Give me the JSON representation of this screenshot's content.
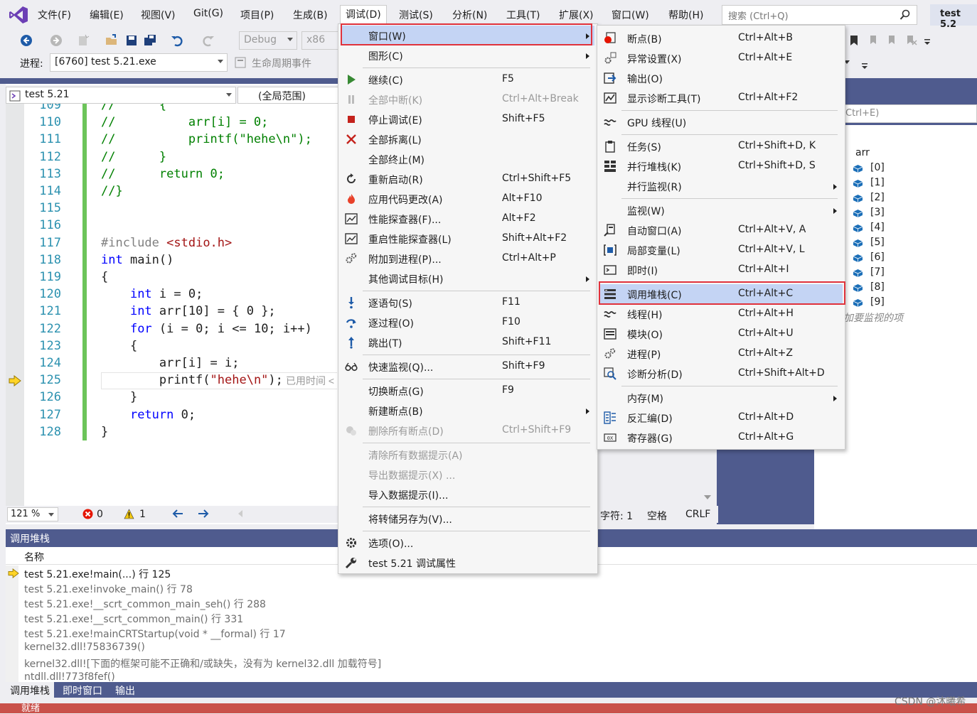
{
  "menubar": {
    "items": [
      "文件(F)",
      "编辑(E)",
      "视图(V)",
      "Git(G)",
      "项目(P)",
      "生成(B)",
      "调试(D)",
      "测试(S)",
      "分析(N)",
      "工具(T)",
      "扩展(X)",
      "窗口(W)",
      "帮助(H)"
    ],
    "search_placeholder": "搜索 (Ctrl+Q)",
    "project_title": "test 5.2"
  },
  "toolbar": {
    "config": "Debug",
    "platform": "x86",
    "process_label": "进程:",
    "process_value": "[6760] test 5.21.exe",
    "lifecycle": "生命周期事件"
  },
  "editor": {
    "scope_combo": "test 5.21",
    "range_combo": "(全局范围)",
    "zoom": "121 %",
    "errors": "0",
    "warnings": "1",
    "status_chars": "字符: 1",
    "status_space": "空格",
    "status_crlf": "CRLF",
    "inline_hint": "已用时间 <",
    "lines": [
      {
        "n": "109",
        "t": "//      {"
      },
      {
        "n": "110",
        "t": "//          arr[i] = 0;"
      },
      {
        "n": "111",
        "t": "//          printf(\"hehe\\n\");"
      },
      {
        "n": "112",
        "t": "//      }"
      },
      {
        "n": "113",
        "t": "//      return 0;"
      },
      {
        "n": "114",
        "t": "//}"
      },
      {
        "n": "115",
        "t": ""
      },
      {
        "n": "116",
        "t": ""
      },
      {
        "n": "117",
        "t": "#include <stdio.h>"
      },
      {
        "n": "118",
        "t": "int main()"
      },
      {
        "n": "119",
        "t": "{"
      },
      {
        "n": "120",
        "t": "    int i = 0;"
      },
      {
        "n": "121",
        "t": "    int arr[10] = { 0 };"
      },
      {
        "n": "122",
        "t": "    for (i = 0; i <= 10; i++)"
      },
      {
        "n": "123",
        "t": "    {"
      },
      {
        "n": "124",
        "t": "        arr[i] = i;"
      },
      {
        "n": "125",
        "t": "        printf(\"hehe\\n\");"
      },
      {
        "n": "126",
        "t": "    }"
      },
      {
        "n": "127",
        "t": "    return 0;"
      },
      {
        "n": "128",
        "t": "}"
      }
    ]
  },
  "debug_menu": [
    {
      "label": "窗口(W)",
      "shortcut": "",
      "sub": true,
      "icon": "",
      "disabled": false
    },
    {
      "label": "图形(C)",
      "shortcut": "",
      "sub": true,
      "icon": "",
      "disabled": false
    },
    {
      "label": "继续(C)",
      "shortcut": "F5",
      "sub": false,
      "icon": "play-icon",
      "disabled": false
    },
    {
      "label": "全部中断(K)",
      "shortcut": "Ctrl+Alt+Break",
      "sub": false,
      "icon": "pause-icon",
      "disabled": true
    },
    {
      "label": "停止调试(E)",
      "shortcut": "Shift+F5",
      "sub": false,
      "icon": "stop-icon",
      "disabled": false
    },
    {
      "label": "全部拆离(L)",
      "shortcut": "",
      "sub": false,
      "icon": "detach-icon",
      "disabled": false
    },
    {
      "label": "全部终止(M)",
      "shortcut": "",
      "sub": false,
      "icon": "",
      "disabled": false
    },
    {
      "label": "重新启动(R)",
      "shortcut": "Ctrl+Shift+F5",
      "sub": false,
      "icon": "restart-icon",
      "disabled": false
    },
    {
      "label": "应用代码更改(A)",
      "shortcut": "Alt+F10",
      "sub": false,
      "icon": "hot-reload-icon",
      "disabled": false
    },
    {
      "label": "性能探查器(F)...",
      "shortcut": "Alt+F2",
      "sub": false,
      "icon": "profiler-icon",
      "disabled": false
    },
    {
      "label": "重启性能探查器(L)",
      "shortcut": "Shift+Alt+F2",
      "sub": false,
      "icon": "profiler-icon",
      "disabled": false
    },
    {
      "label": "附加到进程(P)...",
      "shortcut": "Ctrl+Alt+P",
      "sub": false,
      "icon": "gears-icon",
      "disabled": false
    },
    {
      "label": "其他调试目标(H)",
      "shortcut": "",
      "sub": true,
      "icon": "",
      "disabled": false
    },
    {
      "label": "逐语句(S)",
      "shortcut": "F11",
      "sub": false,
      "icon": "step-into-icon",
      "disabled": false
    },
    {
      "label": "逐过程(O)",
      "shortcut": "F10",
      "sub": false,
      "icon": "step-over-icon",
      "disabled": false
    },
    {
      "label": "跳出(T)",
      "shortcut": "Shift+F11",
      "sub": false,
      "icon": "step-out-icon",
      "disabled": false
    },
    {
      "label": "快速监视(Q)...",
      "shortcut": "Shift+F9",
      "sub": false,
      "icon": "glasses-icon",
      "disabled": false
    },
    {
      "label": "切换断点(G)",
      "shortcut": "F9",
      "sub": false,
      "icon": "",
      "disabled": false
    },
    {
      "label": "新建断点(B)",
      "shortcut": "",
      "sub": true,
      "icon": "",
      "disabled": false
    },
    {
      "label": "删除所有断点(D)",
      "shortcut": "Ctrl+Shift+F9",
      "sub": false,
      "icon": "delete-breakpoints-icon",
      "disabled": true
    },
    {
      "label": "清除所有数据提示(A)",
      "shortcut": "",
      "sub": false,
      "icon": "",
      "disabled": true
    },
    {
      "label": "导出数据提示(X) ...",
      "shortcut": "",
      "sub": false,
      "icon": "",
      "disabled": true
    },
    {
      "label": "导入数据提示(I)...",
      "shortcut": "",
      "sub": false,
      "icon": "",
      "disabled": false
    },
    {
      "label": "将转储另存为(V)...",
      "shortcut": "",
      "sub": false,
      "icon": "",
      "disabled": false
    },
    {
      "label": "选项(O)...",
      "shortcut": "",
      "sub": false,
      "icon": "gear-icon",
      "disabled": false
    },
    {
      "label": "test 5.21 调试属性",
      "shortcut": "",
      "sub": false,
      "icon": "wrench-icon",
      "disabled": false
    }
  ],
  "window_submenu": [
    {
      "label": "断点(B)",
      "shortcut": "Ctrl+Alt+B",
      "sub": false,
      "icon": "breakpoints-icon"
    },
    {
      "label": "异常设置(X)",
      "shortcut": "Ctrl+Alt+E",
      "sub": false,
      "icon": "exception-icon"
    },
    {
      "label": "输出(O)",
      "shortcut": "",
      "sub": false,
      "icon": "output-icon"
    },
    {
      "label": "显示诊断工具(T)",
      "shortcut": "Ctrl+Alt+F2",
      "sub": false,
      "icon": "diagnostics-icon"
    },
    {
      "label": "GPU 线程(U)",
      "shortcut": "",
      "sub": false,
      "icon": "threads-icon"
    },
    {
      "label": "任务(S)",
      "shortcut": "Ctrl+Shift+D, K",
      "sub": false,
      "icon": "tasks-icon"
    },
    {
      "label": "并行堆栈(K)",
      "shortcut": "Ctrl+Shift+D, S",
      "sub": false,
      "icon": "parallel-stacks-icon"
    },
    {
      "label": "并行监视(R)",
      "shortcut": "",
      "sub": true,
      "icon": ""
    },
    {
      "label": "监视(W)",
      "shortcut": "",
      "sub": true,
      "icon": ""
    },
    {
      "label": "自动窗口(A)",
      "shortcut": "Ctrl+Alt+V, A",
      "sub": false,
      "icon": "autos-icon"
    },
    {
      "label": "局部变量(L)",
      "shortcut": "Ctrl+Alt+V, L",
      "sub": false,
      "icon": "locals-icon"
    },
    {
      "label": "即时(I)",
      "shortcut": "Ctrl+Alt+I",
      "sub": false,
      "icon": "immediate-icon"
    },
    {
      "label": "调用堆栈(C)",
      "shortcut": "Ctrl+Alt+C",
      "sub": false,
      "icon": "call-stack-icon"
    },
    {
      "label": "线程(H)",
      "shortcut": "Ctrl+Alt+H",
      "sub": false,
      "icon": "threads-icon"
    },
    {
      "label": "模块(O)",
      "shortcut": "Ctrl+Alt+U",
      "sub": false,
      "icon": "modules-icon"
    },
    {
      "label": "进程(P)",
      "shortcut": "Ctrl+Alt+Z",
      "sub": false,
      "icon": "gears-icon"
    },
    {
      "label": "诊断分析(D)",
      "shortcut": "Ctrl+Shift+Alt+D",
      "sub": false,
      "icon": "analysis-icon"
    },
    {
      "label": "内存(M)",
      "shortcut": "",
      "sub": true,
      "icon": ""
    },
    {
      "label": "反汇编(D)",
      "shortcut": "Ctrl+Alt+D",
      "sub": false,
      "icon": "disassembly-icon"
    },
    {
      "label": "寄存器(G)",
      "shortcut": "Ctrl+Alt+G",
      "sub": false,
      "icon": "registers-icon"
    }
  ],
  "watch": {
    "search_hint": "Ctrl+E)",
    "root": "arr",
    "items": [
      "[0]",
      "[1]",
      "[2]",
      "[3]",
      "[4]",
      "[5]",
      "[6]",
      "[7]",
      "[8]",
      "[9]"
    ],
    "add_hint": "加要监视的项"
  },
  "callstack": {
    "title": "调用堆栈",
    "column_name": "名称",
    "rows": [
      "test 5.21.exe!main(...) 行 125",
      "test 5.21.exe!invoke_main() 行 78",
      "test 5.21.exe!__scrt_common_main_seh() 行 288",
      "test 5.21.exe!__scrt_common_main() 行 331",
      "test 5.21.exe!mainCRTStartup(void * __formal) 行 17",
      "kernel32.dll!75836739()",
      "kernel32.dll![下面的框架可能不正确和/或缺失，没有为 kernel32.dll 加载符号]",
      "ntdll.dll!773f8fef()"
    ]
  },
  "bottom_tabs": [
    "调用堆栈",
    "即时窗口",
    "输出"
  ],
  "status": {
    "ready": "就绪"
  },
  "watermark": "CSDN @沐曦希",
  "colors": {
    "accent": "#4f5b8e",
    "highlight": "#c4d4f4",
    "redbox": "#e0323c",
    "status": "#c9514a"
  }
}
